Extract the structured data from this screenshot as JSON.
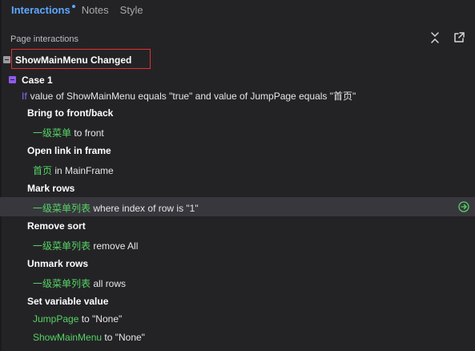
{
  "tabs": [
    {
      "label": "Interactions",
      "active": true
    },
    {
      "label": "Notes",
      "active": false
    },
    {
      "label": "Style",
      "active": false
    }
  ],
  "panel": {
    "section_title": "Page interactions",
    "collapse_icon": "collapse-all-icon",
    "popout_icon": "popout-icon"
  },
  "event": {
    "label": "ShowMainMenu Changed"
  },
  "case": {
    "label": "Case 1",
    "condition_keyword": "If",
    "condition_text": "value of ShowMainMenu equals \"true\" and value of JumpPage equals \"首页\""
  },
  "actions": [
    {
      "title": "Bring to front/back",
      "target": "一级菜单",
      "rest": " to front"
    },
    {
      "title": "Open link in frame",
      "target": "首页",
      "rest": " in MainFrame"
    },
    {
      "title": "Mark rows",
      "target": "一级菜单列表",
      "rest": " where index of row is \"1\"",
      "highlighted": true
    },
    {
      "title": "Remove sort",
      "target": "一级菜单列表",
      "rest": " remove All"
    },
    {
      "title": "Unmark rows",
      "target": "一级菜单列表",
      "rest": " all rows"
    },
    {
      "title": "Set variable value",
      "details": [
        {
          "target": "JumpPage",
          "rest": " to \"None\""
        },
        {
          "target": "ShowMainMenu",
          "rest": " to \"None\""
        }
      ]
    }
  ],
  "colors": {
    "background": "#232326",
    "accent": "#5ea8ff",
    "case_purple": "#8f5bf0",
    "target_green": "#56d364",
    "highlight_row": "#37373d",
    "event_outline": "#e2312d"
  }
}
